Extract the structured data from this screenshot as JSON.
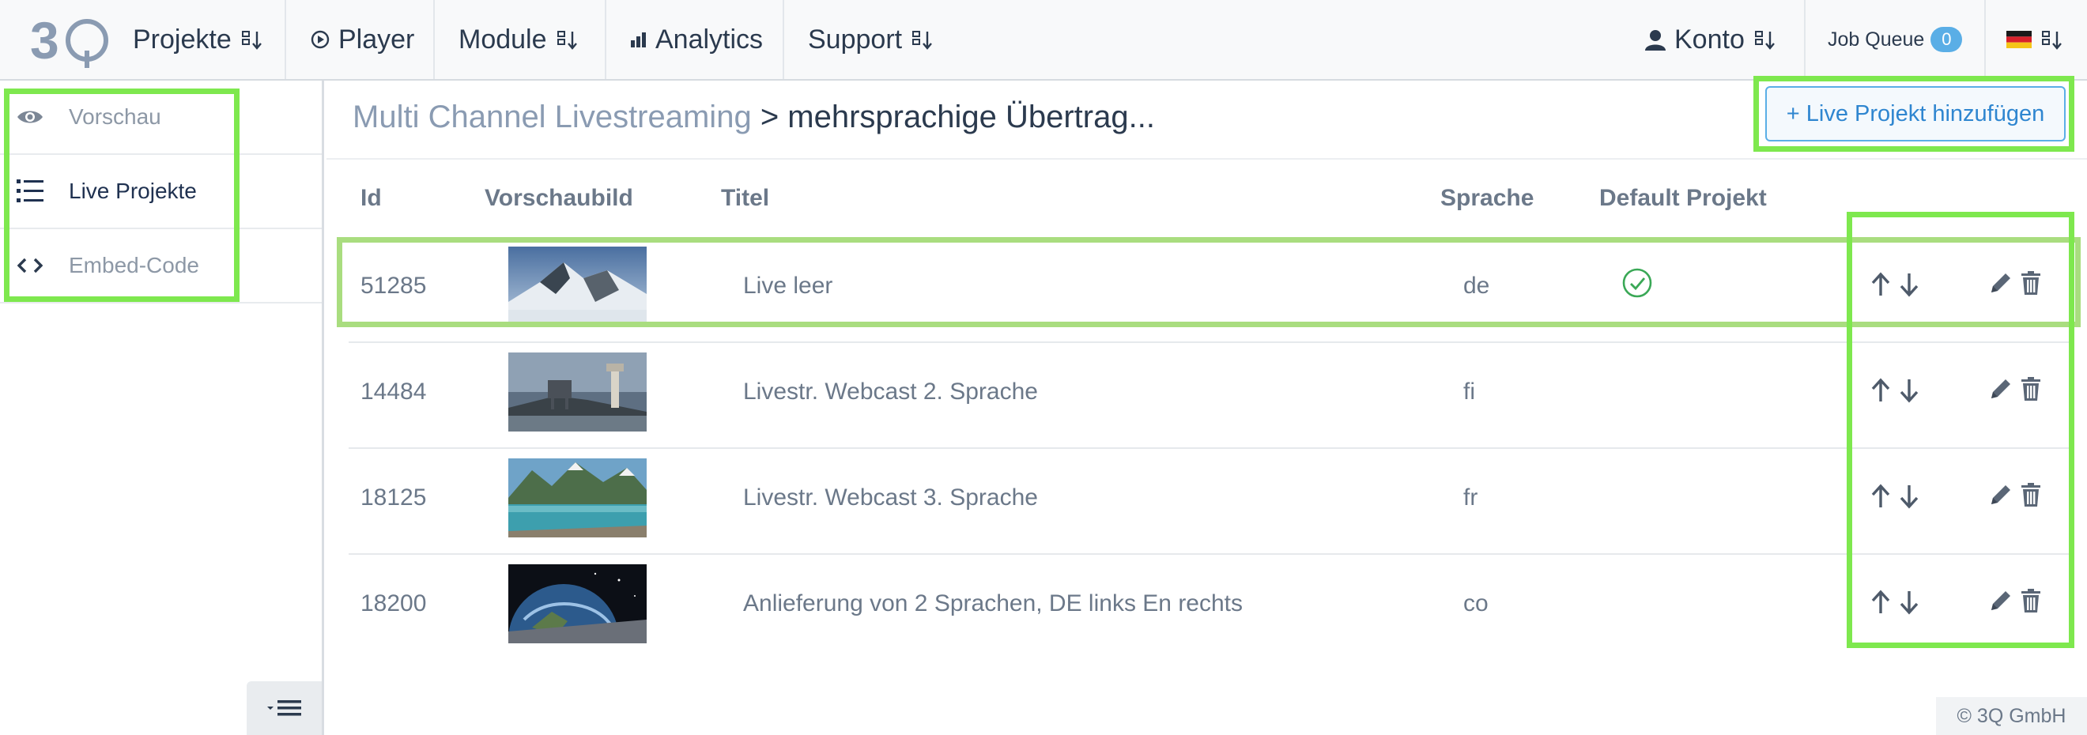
{
  "topnav": {
    "logo_text": "3Q",
    "items": [
      {
        "label": "Projekte"
      },
      {
        "label": "Player"
      },
      {
        "label": "Module"
      },
      {
        "label": "Analytics"
      },
      {
        "label": "Support"
      }
    ],
    "account_label": "Konto",
    "job_queue_label": "Job Queue",
    "job_queue_count": "0",
    "language_flag": "de-flag-icon"
  },
  "sidebar": {
    "items": [
      {
        "label": "Vorschau",
        "icon": "eye-icon",
        "active": false
      },
      {
        "label": "Live Projekte",
        "icon": "list-icon",
        "active": true
      },
      {
        "label": "Embed-Code",
        "icon": "code-icon",
        "active": false
      }
    ],
    "collapse_icon": "collapse-menu-icon"
  },
  "breadcrumb": {
    "parent": "Multi Channel Livestreaming",
    "separator": ">",
    "current": "mehrsprachige Übertrag..."
  },
  "add_button_label": "+ Live Projekt hinzufügen",
  "table": {
    "headers": [
      "Id",
      "Vorschaubild",
      "Titel",
      "Sprache",
      "Default Projekt"
    ],
    "rows": [
      {
        "id": "51285",
        "title": "Live leer",
        "language": "de",
        "default": true
      },
      {
        "id": "14484",
        "title": "Livestr. Webcast 2. Sprache",
        "language": "fi",
        "default": false
      },
      {
        "id": "18125",
        "title": "Livestr. Webcast 3. Sprache",
        "language": "fr",
        "default": false
      },
      {
        "id": "18200",
        "title": "Anlieferung von 2 Sprachen, DE links En rechts",
        "language": "co",
        "default": false
      }
    ]
  },
  "footer": "© 3Q GmbH",
  "colors": {
    "accent_blue": "#5aaee6",
    "highlight_green": "#7ee84e",
    "check_green": "#3aa856",
    "text_dark": "#2b3a4e",
    "text_muted": "#6b7889"
  }
}
